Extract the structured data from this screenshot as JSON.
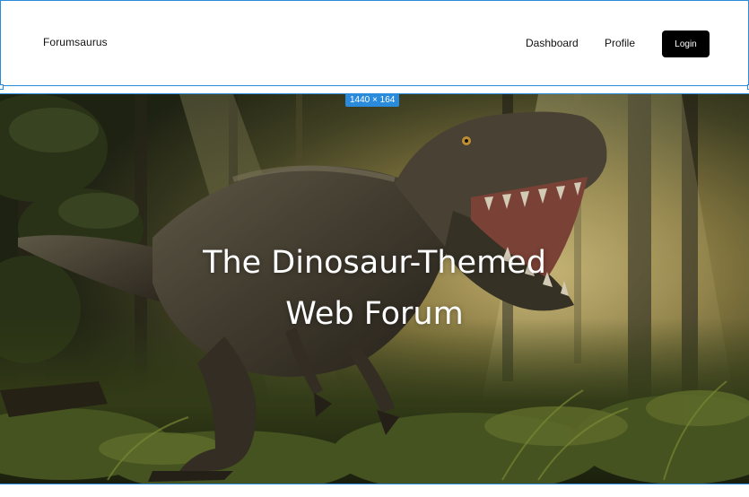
{
  "header": {
    "logo": "Forumsaurus",
    "nav": {
      "dashboard": "Dashboard",
      "profile": "Profile"
    },
    "login_label": "Login"
  },
  "selection": {
    "dimension_label": "1440 × 164",
    "color": "#2a8bdc"
  },
  "hero": {
    "title_line1": "The Dinosaur-Themed",
    "title_line2": "Web Forum",
    "image_subject": "t-rex-in-forest"
  }
}
